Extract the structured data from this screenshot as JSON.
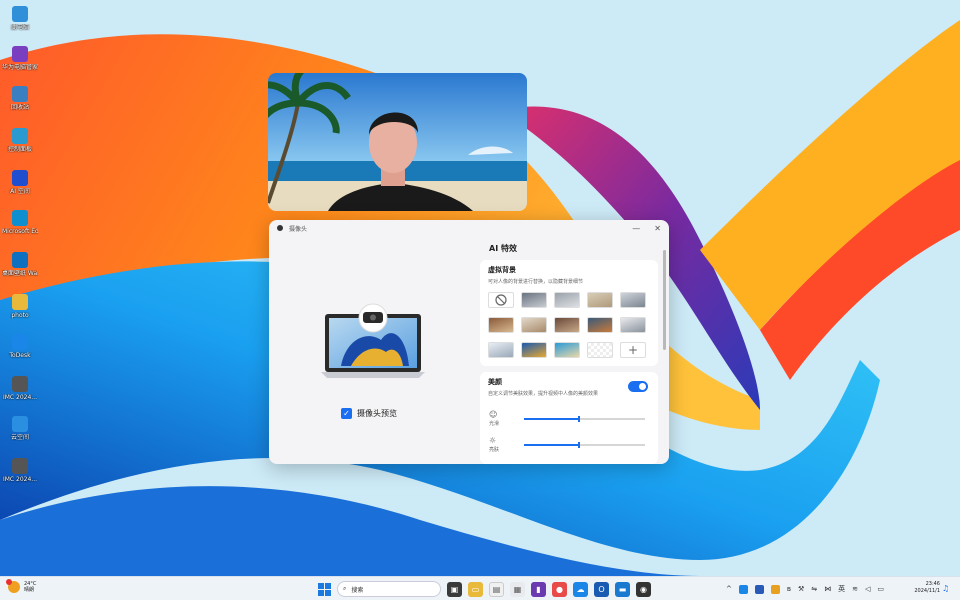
{
  "desktop": {
    "icons": [
      {
        "label": "此电脑",
        "icon": "computer-icon",
        "color": "#2f8fd8"
      },
      {
        "label": "华为电脑管家",
        "icon": "pc-manager-icon",
        "color": "#7a3fc0"
      },
      {
        "label": "回收站",
        "icon": "recycle-bin-icon",
        "color": "#3a7fc2"
      },
      {
        "label": "控制面板",
        "icon": "control-panel-icon",
        "color": "#2a9ad0"
      },
      {
        "label": "AI 空间",
        "icon": "ai-space-icon",
        "color": "#1f4fd0"
      },
      {
        "label": "Microsoft Edge",
        "icon": "edge-icon",
        "color": "#0f8fd0"
      },
      {
        "label": "桌面壁纸 Wallpaper",
        "icon": "wallpaper-icon",
        "color": "#1070c0"
      },
      {
        "label": "photo",
        "icon": "folder-icon",
        "color": "#e8b93a"
      },
      {
        "label": "ToDesk",
        "icon": "todesk-icon",
        "color": "#1a86e8"
      },
      {
        "label": "IMC 2024...",
        "icon": "image-file-icon",
        "color": "#555555"
      },
      {
        "label": "云空间",
        "icon": "cloud-icon",
        "color": "#2a8fe0"
      },
      {
        "label": "IMC 2024...",
        "icon": "image-file-icon",
        "color": "#555555"
      }
    ]
  },
  "dialog": {
    "title": "摄像头",
    "minimize": "—",
    "close": "✕",
    "preview_checkbox_label": "摄像头预览",
    "ai_section_title": "AI 特效",
    "virtual_bg": {
      "title": "虚拟背景",
      "desc": "可对人像的背景进行替换，以隐藏背景细节",
      "none_symbol": "⃠",
      "add_symbol": "+",
      "thumbs": [
        {
          "kind": "none"
        },
        {
          "kind": "img",
          "c1": "#6a7380",
          "c2": "#c8ccd2"
        },
        {
          "kind": "img",
          "c1": "#9aa2aa",
          "c2": "#dde0e4"
        },
        {
          "kind": "img",
          "c1": "#d8cdb8",
          "c2": "#b09a7a"
        },
        {
          "kind": "img",
          "c1": "#cfd4da",
          "c2": "#7c8590"
        },
        {
          "kind": "img",
          "c1": "#8a5a3a",
          "c2": "#d8b890"
        },
        {
          "kind": "img",
          "c1": "#e2d8c8",
          "c2": "#a88a6a"
        },
        {
          "kind": "img",
          "c1": "#6a4a3a",
          "c2": "#c8a888"
        },
        {
          "kind": "img",
          "c1": "#3a5a7a",
          "c2": "#c87a3a"
        },
        {
          "kind": "img",
          "c1": "#e8eaee",
          "c2": "#8a929c"
        },
        {
          "kind": "img",
          "c1": "#e8eef4",
          "c2": "#9aa8b8"
        },
        {
          "kind": "img",
          "c1": "#1a5ab0",
          "c2": "#e8a830"
        },
        {
          "kind": "img",
          "c1": "#2a9ad8",
          "c2": "#e8d8a8"
        },
        {
          "kind": "blur"
        },
        {
          "kind": "add"
        }
      ]
    },
    "beauty": {
      "title": "美颜",
      "desc": "自定义调节美肤效果，提升视频中人像的美颜效果",
      "enabled": true,
      "sliders": [
        {
          "label": "光滑",
          "icon": "face-icon",
          "value": 0.45
        },
        {
          "label": "亮肤",
          "icon": "brightness-icon",
          "value": 0.45
        }
      ]
    }
  },
  "taskbar": {
    "weather_temp": "24°C",
    "weather_desc": "晴朗",
    "search_placeholder": "搜索",
    "ime": "英",
    "time": "23:46",
    "date": "2024/11/1",
    "accent": "#1a6ef0"
  }
}
